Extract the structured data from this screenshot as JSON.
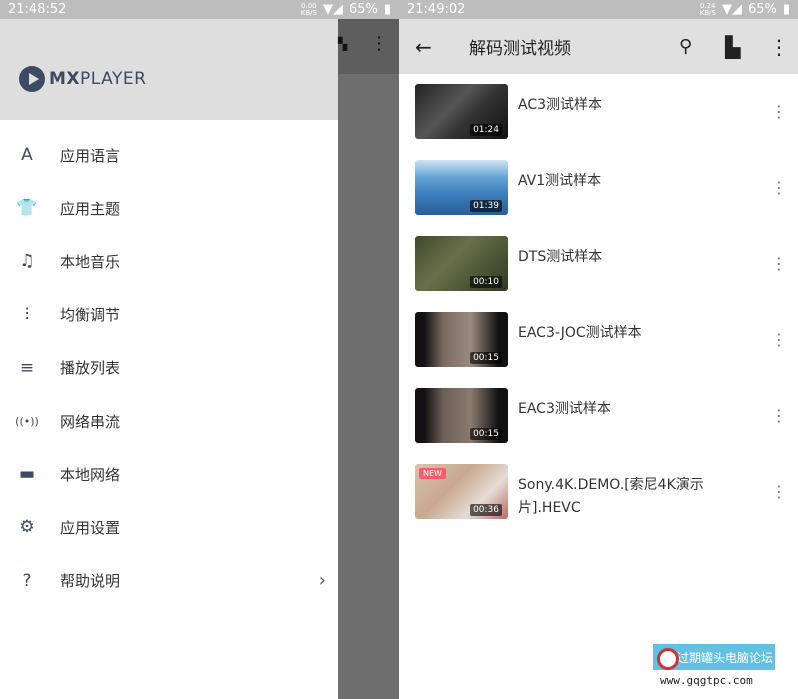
{
  "left": {
    "status": {
      "time": "21:48:52",
      "speed": "0.00",
      "speed_unit": "KB/S",
      "battery": "65%"
    },
    "logo": {
      "bold": "MX",
      "rest": "PLAYER"
    },
    "menu": [
      {
        "label": "应用语言",
        "icon": "language-icon",
        "glyph": "A"
      },
      {
        "label": "应用主题",
        "icon": "tshirt-icon",
        "glyph": "👕"
      },
      {
        "label": "本地音乐",
        "icon": "music-folder-icon",
        "glyph": "♫"
      },
      {
        "label": "均衡调节",
        "icon": "equalizer-icon",
        "glyph": "⫶"
      },
      {
        "label": "播放列表",
        "icon": "playlist-icon",
        "glyph": "≡"
      },
      {
        "label": "网络串流",
        "icon": "stream-icon",
        "glyph": "((•))"
      },
      {
        "label": "本地网络",
        "icon": "monitor-icon",
        "glyph": "▬"
      },
      {
        "label": "应用设置",
        "icon": "gear-icon",
        "glyph": "⚙"
      },
      {
        "label": "帮助说明",
        "icon": "help-icon",
        "glyph": "?"
      }
    ]
  },
  "right": {
    "status": {
      "time": "21:49:02",
      "speed": "0.24",
      "speed_unit": "KB/S",
      "battery": "65%"
    },
    "title": "解码测试视频",
    "videos": [
      {
        "title": "AC3测试样本",
        "duration": "01:24",
        "bg": "linear-gradient(135deg,#222,#555 40%,#333 60%,#111)"
      },
      {
        "title": "AV1测试样本",
        "duration": "01:39",
        "bg": "linear-gradient(180deg,#cfe3f3 0%,#6aa7d8 30%,#3e7fbd 60%,#2a5f95)"
      },
      {
        "title": "DTS测试样本",
        "duration": "00:10",
        "bg": "linear-gradient(135deg,#3e4a2c,#6a6f48 40%,#2f3a24)"
      },
      {
        "title": "EAC3-JOC测试样本",
        "duration": "00:15",
        "bg": "linear-gradient(90deg,#111 10%,#7a6a60 30%,#9a8a80 60%,#111 90%)"
      },
      {
        "title": "EAC3测试样本",
        "duration": "00:15",
        "bg": "linear-gradient(90deg,#111 10%,#6a5e56 30%,#8a7a70 60%,#111 90%)"
      },
      {
        "title": "Sony.4K.DEMO.[索尼4K演示片].HEVC",
        "duration": "00:36",
        "badge": "NEW",
        "bg": "linear-gradient(135deg,#d8c3b0,#c8a890 40%,#e5ddd5 70%,#b66)"
      }
    ]
  },
  "watermark": {
    "name": "过期罐头电脑论坛",
    "url": "www.gqgtpc.com"
  }
}
